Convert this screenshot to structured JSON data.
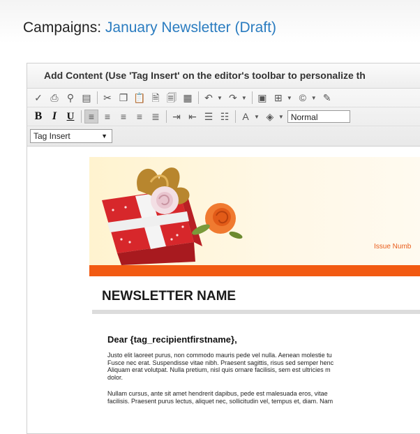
{
  "page": {
    "title_prefix": "Campaigns: ",
    "title_link": "January Newsletter (Draft)"
  },
  "editor": {
    "header": "Add Content (Use 'Tag Insert' on the editor's toolbar to personalize th",
    "toolbar1": [
      {
        "name": "spellcheck-icon",
        "glyph": "✓"
      },
      {
        "name": "print-icon",
        "glyph": "⎙"
      },
      {
        "name": "find-icon",
        "glyph": "⚲"
      },
      {
        "name": "select-all-icon",
        "glyph": "▤"
      },
      {
        "sep": true
      },
      {
        "name": "cut-icon",
        "glyph": "✂"
      },
      {
        "name": "copy-icon",
        "glyph": "❐"
      },
      {
        "name": "paste-icon",
        "glyph": "📋"
      },
      {
        "name": "paste-from-word-icon",
        "glyph": "🗎"
      },
      {
        "name": "paste-plain-text-icon",
        "glyph": "🗐"
      },
      {
        "name": "paste-html-icon",
        "glyph": "▦"
      },
      {
        "sep": true
      },
      {
        "name": "undo-icon",
        "glyph": "↶",
        "arrow": true
      },
      {
        "name": "redo-icon",
        "glyph": "↷",
        "arrow": true
      },
      {
        "sep": true
      },
      {
        "name": "image-manager-icon",
        "glyph": "▣"
      },
      {
        "name": "insert-table-icon",
        "glyph": "⊞",
        "arrow": true
      },
      {
        "name": "insert-symbol-icon",
        "glyph": "©",
        "arrow": true
      },
      {
        "name": "insert-link-icon",
        "glyph": "✎"
      }
    ],
    "toolbar2": [
      {
        "name": "bold-icon",
        "glyph": "B",
        "cls": "bold-b"
      },
      {
        "name": "italic-icon",
        "glyph": "I",
        "cls": "ital-i"
      },
      {
        "name": "underline-icon",
        "glyph": "U",
        "cls": "und-u"
      },
      {
        "sep": true
      },
      {
        "name": "align-left-icon",
        "glyph": "≡",
        "active": true
      },
      {
        "name": "align-center-icon",
        "glyph": "≡"
      },
      {
        "name": "align-right-icon",
        "glyph": "≡"
      },
      {
        "name": "align-justify-icon",
        "glyph": "≡"
      },
      {
        "name": "justify-none-icon",
        "glyph": "≣"
      },
      {
        "sep": true
      },
      {
        "name": "indent-icon",
        "glyph": "⇥"
      },
      {
        "name": "outdent-icon",
        "glyph": "⇤"
      },
      {
        "name": "numbered-list-icon",
        "glyph": "☰"
      },
      {
        "name": "bullet-list-icon",
        "glyph": "☷"
      },
      {
        "sep": true
      },
      {
        "name": "font-color-icon",
        "glyph": "A",
        "arrow": true
      },
      {
        "name": "background-color-icon",
        "glyph": "◈",
        "arrow": true
      }
    ],
    "format_value": "Normal",
    "tag_insert": "Tag Insert"
  },
  "newsletter": {
    "issue_label": "Issue Numb",
    "name": "NEWSLETTER NAME",
    "greeting": "Dear {tag_recipientfirstname},",
    "para1": [
      "Justo elit laoreet purus, non commodo mauris pede vel nulla. Aenean molestie tu",
      "Fusce nec erat. Suspendisse vitae nibh. Praesent sagittis, risus sed semper henc",
      "Aliquam erat volutpat. Nulla pretium, nisl quis ornare facilisis, sem est ultricies m",
      "dolor."
    ],
    "para2": [
      "Nullam cursus, ante sit amet hendrerit dapibus, pede est malesuada eros, vitae",
      "facilisis. Praesent purus lectus, aliquet nec, sollicitudin vel, tempus et, diam. Nam"
    ],
    "colors": {
      "accent_orange": "#f25a12",
      "link_blue": "#2a7cc0"
    }
  }
}
